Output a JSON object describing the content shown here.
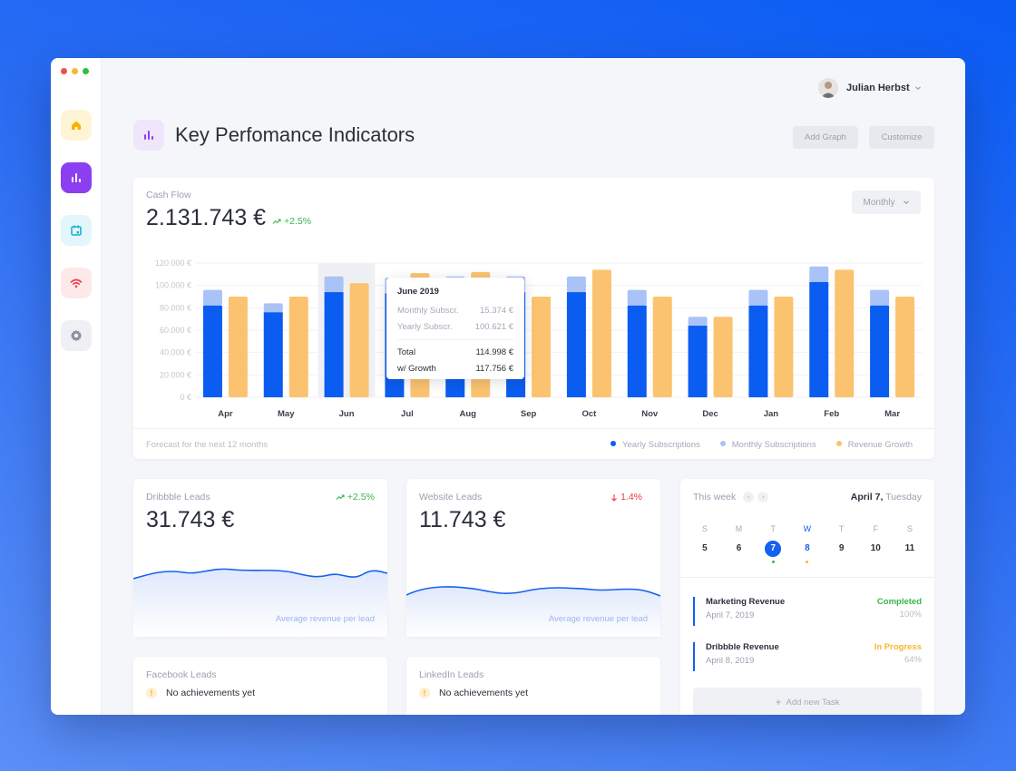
{
  "window": {
    "traffic_lights": [
      "#f0504a",
      "#f5b82e",
      "#2ac140"
    ]
  },
  "sidebar": {
    "items": [
      {
        "icon": "home-icon",
        "bg": "#fff4d6",
        "color": "#f5b200"
      },
      {
        "icon": "bar-chart-icon",
        "bg": "#8b3ff0",
        "color": "#ffffff"
      },
      {
        "icon": "calendar-icon",
        "bg": "#e2f6fb",
        "color": "#1bb0d8"
      },
      {
        "icon": "wifi-icon",
        "bg": "#fde9ea",
        "color": "#ef3b4a"
      },
      {
        "icon": "gear-icon",
        "bg": "#eef0f3",
        "color": "#8b919d"
      }
    ]
  },
  "header": {
    "user_name": "Julian Herbst",
    "title": "Key Perfomance Indicators",
    "add_graph": "Add Graph",
    "customize": "Customize"
  },
  "cashflow": {
    "label": "Cash Flow",
    "value": "2.131.743 €",
    "growth": "+2.5%",
    "period": "Monthly",
    "footer": "Forecast for the next 12 months",
    "legend": [
      "Yearly Subscriptions",
      "Monthly Subscriptions",
      "Revenue Growth"
    ],
    "tooltip": {
      "title": "June 2019",
      "rows": [
        {
          "label": "Monthly Subscr.",
          "value": "15.374 €"
        },
        {
          "label": "Yearly Subscr.",
          "value": "100.621 €"
        }
      ],
      "total_label": "Total",
      "total_value": "114.998 €",
      "growth_label": "w/ Growth",
      "growth_value": "117.756 €"
    }
  },
  "chart_data": {
    "type": "bar",
    "categories": [
      "Apr",
      "May",
      "Jun",
      "Jul",
      "Aug",
      "Sep",
      "Oct",
      "Nov",
      "Dec",
      "Jan",
      "Feb",
      "Mar"
    ],
    "ylim": [
      0,
      120000
    ],
    "yticks": [
      "120.000 €",
      "100.000 €",
      "80.000 €",
      "60.000 €",
      "40.000 €",
      "20.000 €",
      "0 €"
    ],
    "ytick_values": [
      120000,
      100000,
      80000,
      60000,
      40000,
      20000,
      0
    ],
    "highlight_index": 2,
    "series": [
      {
        "name": "Yearly Subscriptions",
        "color": "#0b5cf0",
        "values": [
          82000,
          76000,
          94000,
          93000,
          94000,
          94000,
          94000,
          82000,
          64000,
          82000,
          103000,
          82000
        ]
      },
      {
        "name": "Monthly Subscriptions",
        "color": "#a9c2f7",
        "values": [
          14000,
          8000,
          14000,
          14000,
          14000,
          14000,
          14000,
          14000,
          8000,
          14000,
          14000,
          14000
        ]
      },
      {
        "name": "Revenue Growth",
        "color": "#fbc36f",
        "values": [
          90000,
          90000,
          102000,
          111000,
          112000,
          90000,
          114000,
          90000,
          72000,
          90000,
          114000,
          90000
        ]
      }
    ]
  },
  "dribbble": {
    "label": "Dribbble Leads",
    "value": "31.743 €",
    "growth": "+2.5%",
    "caption": "Average revenue per lead"
  },
  "website": {
    "label": "Website Leads",
    "value": "11.743 €",
    "growth": "1.4%",
    "caption": "Average revenue per lead"
  },
  "facebook": {
    "label": "Facebook Leads",
    "message": "No achievements yet"
  },
  "linkedin": {
    "label": "LinkedIn Leads",
    "message": "No achievements yet"
  },
  "calendar": {
    "label": "This week",
    "date_bold": "April 7,",
    "date_weekday": "Tuesday",
    "days": [
      {
        "wd": "S",
        "dn": "5"
      },
      {
        "wd": "M",
        "dn": "6"
      },
      {
        "wd": "T",
        "dn": "7"
      },
      {
        "wd": "W",
        "dn": "8"
      },
      {
        "wd": "T",
        "dn": "9"
      },
      {
        "wd": "F",
        "dn": "10"
      },
      {
        "wd": "S",
        "dn": "11"
      }
    ],
    "tasks": [
      {
        "name": "Marketing Revenue",
        "date": "April 7, 2019",
        "status": "Completed",
        "status_color": "#39b54a",
        "pct": "100%"
      },
      {
        "name": "Dribbble Revenue",
        "date": "April 8, 2019",
        "status": "In Progress",
        "status_color": "#f5b82e",
        "pct": "64%"
      }
    ],
    "add_task": "Add new Task"
  }
}
